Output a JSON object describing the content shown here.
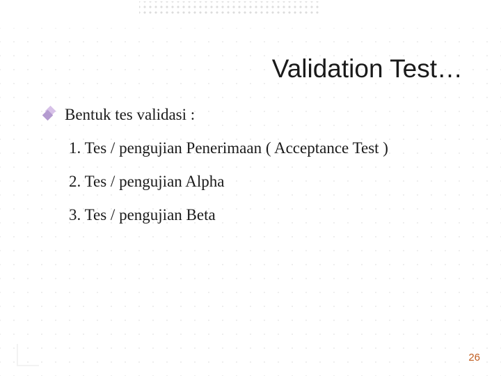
{
  "slide": {
    "title": "Validation Test…",
    "bullet_heading": "Bentuk tes validasi :",
    "items": [
      "1. Tes / pengujian Penerimaan ( Acceptance Test )",
      "2. Tes / pengujian Alpha",
      "3. Tes / pengujian Beta"
    ],
    "page_number": "26"
  }
}
